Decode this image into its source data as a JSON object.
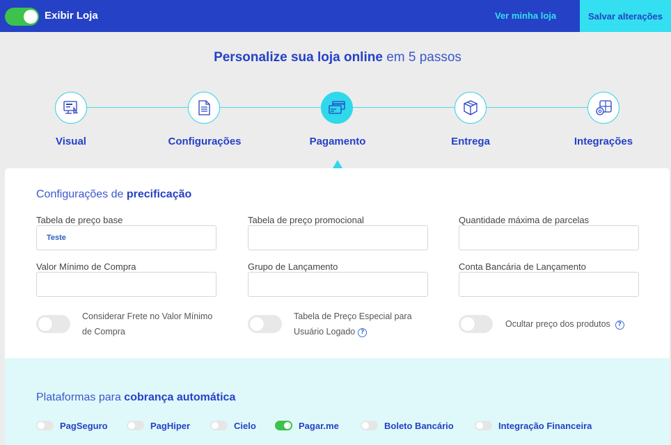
{
  "topbar": {
    "toggle_label": "Exibir Loja",
    "toggle_on": true,
    "view_link": "Ver minha loja",
    "save_button": "Salvar alterações"
  },
  "heading": {
    "bold": "Personalize sua loja online",
    "light": "em 5 passos"
  },
  "steps": [
    {
      "label": "Visual",
      "icon": "monitor-icon"
    },
    {
      "label": "Configurações",
      "icon": "document-icon"
    },
    {
      "label": "Pagamento",
      "icon": "card-payment-icon",
      "active": true
    },
    {
      "label": "Entrega",
      "icon": "package-box-icon"
    },
    {
      "label": "Integrações",
      "icon": "puzzle-gear-icon"
    }
  ],
  "pricing": {
    "title_light": "Configurações de",
    "title_bold": "precificação",
    "fields": [
      {
        "label": "Tabela de preço base",
        "value": "Teste",
        "placeholder": ""
      },
      {
        "label": "Tabela de preço promocional",
        "value": "",
        "placeholder": ""
      },
      {
        "label": "Quantidade máxima de parcelas",
        "value": "",
        "placeholder": ""
      },
      {
        "label": "Valor Mínimo de Compra",
        "value": "",
        "placeholder": ""
      },
      {
        "label": "Grupo de Lançamento",
        "value": "",
        "placeholder": ""
      },
      {
        "label": "Conta Bancária de Lançamento",
        "value": "",
        "placeholder": ""
      }
    ],
    "toggles": [
      {
        "line1": "Considerar Frete no Valor Mínimo",
        "line2": "de Compra",
        "on": false,
        "help": false
      },
      {
        "line1": "Tabela de Preço Especial para",
        "line2": "Usuário Logado",
        "on": false,
        "help": true
      },
      {
        "line1": "Ocultar preço dos produtos",
        "on": false,
        "help": true
      }
    ]
  },
  "platforms": {
    "title_light": "Plataformas para",
    "title_bold": "cobrança automática",
    "items": [
      {
        "label": "PagSeguro",
        "on": false
      },
      {
        "label": "PagHiper",
        "on": false
      },
      {
        "label": "Cielo",
        "on": false
      },
      {
        "label": "Pagar.me",
        "on": true
      },
      {
        "label": "Boleto Bancário",
        "on": false
      },
      {
        "label": "Integração Financeira",
        "on": false
      }
    ]
  },
  "colors": {
    "brand_blue": "#2541c6",
    "accent_cyan": "#2fd8ea",
    "toggle_green": "#3cc24d",
    "platform_bg": "#dff9fa"
  }
}
